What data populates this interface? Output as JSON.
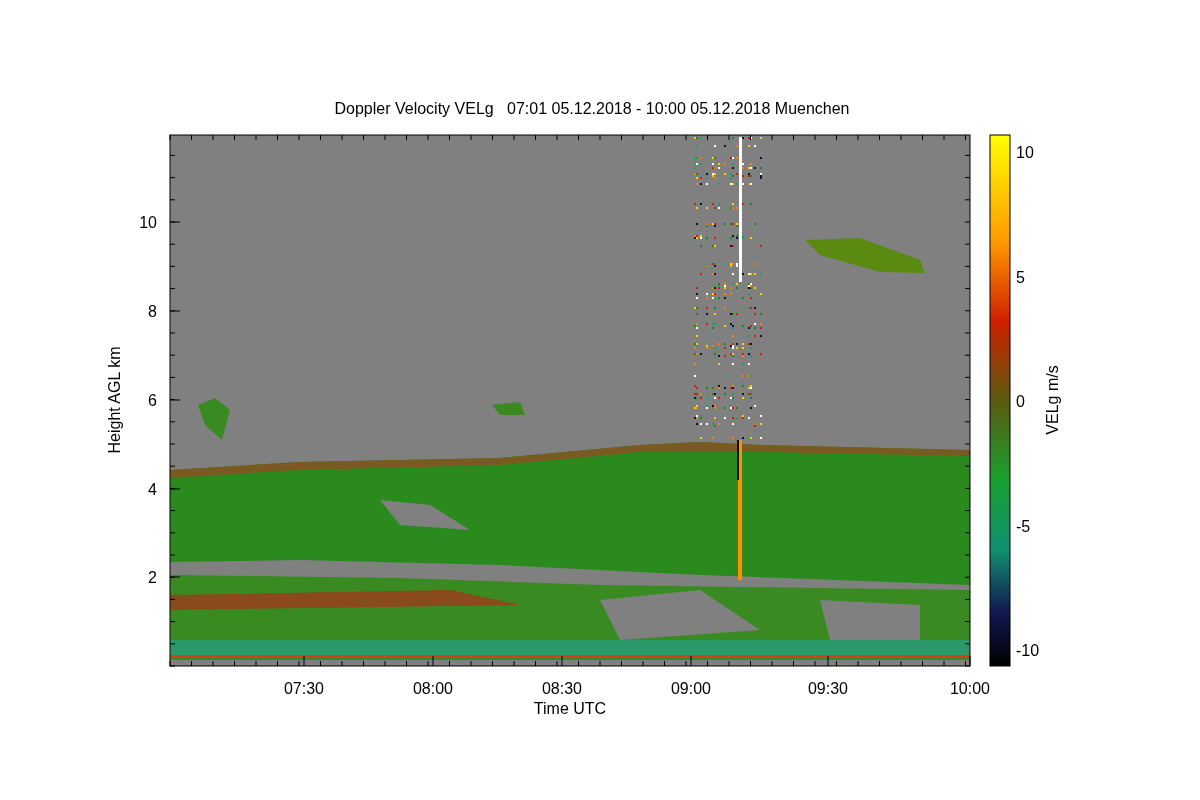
{
  "title": "Doppler Velocity VELg   07:01 05.12.2018 - 10:00 05.12.2018 Muenchen",
  "plot": {
    "xlabel": "Time UTC",
    "ylabel": "Height AGL km",
    "xticks": [
      "07:30",
      "08:00",
      "08:30",
      "09:00",
      "09:30",
      "10:00"
    ],
    "yticks": [
      "10",
      "8",
      "6",
      "4",
      "2"
    ]
  },
  "colorbar": {
    "label": "VELg m/s",
    "ticks": [
      "10",
      "5",
      "0",
      "-5",
      "-10"
    ]
  }
}
